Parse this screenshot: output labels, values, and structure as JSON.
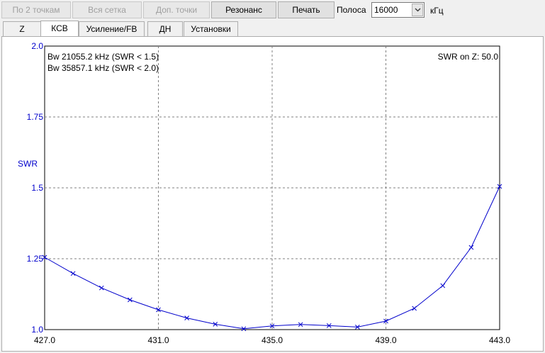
{
  "toolbar": {
    "buttons": [
      {
        "label": "По 2 точкам",
        "enabled": false
      },
      {
        "label": "Вся сетка",
        "enabled": false
      },
      {
        "label": "Доп. точки",
        "enabled": false
      },
      {
        "label": "Резонанс",
        "enabled": true
      },
      {
        "label": "Печать",
        "enabled": true
      }
    ],
    "band_label": "Полоса",
    "band_value": "16000",
    "band_unit": "кГц"
  },
  "tabs": [
    {
      "label": "Z",
      "active": false
    },
    {
      "label": "КСВ",
      "active": true
    },
    {
      "label": "Усиление/FB",
      "active": false
    },
    {
      "label": "ДН",
      "active": false
    },
    {
      "label": "Установки",
      "active": false
    }
  ],
  "colors": {
    "accent": "#0000cc",
    "grid": "#808080"
  },
  "chart_data": {
    "type": "line",
    "ylabel": "SWR",
    "xlim": [
      427.0,
      443.0
    ],
    "ylim": [
      1.0,
      2.0
    ],
    "x_ticks": [
      "427.0",
      "431.0",
      "435.0",
      "439.0",
      "443.0"
    ],
    "y_ticks": [
      "2.0",
      "1.75",
      "1.5",
      "1.25",
      "1.0"
    ],
    "grid": true,
    "annotations": {
      "bw1": "Bw 21055.2 kHz (SWR < 1.5)",
      "bw2": "Bw 35857.1 kHz (SWR < 2.0)",
      "swr_on_z": "SWR on Z: 50.0"
    },
    "series": [
      {
        "x": [
          427.0,
          428.0,
          429.0,
          430.0,
          431.0,
          432.0,
          433.0,
          434.0,
          435.0,
          436.0,
          437.0,
          438.0,
          439.0,
          440.0,
          441.0,
          442.0,
          443.0
        ],
        "y": [
          1.255,
          1.198,
          1.147,
          1.105,
          1.07,
          1.041,
          1.019,
          1.003,
          1.013,
          1.018,
          1.014,
          1.009,
          1.03,
          1.075,
          1.155,
          1.29,
          1.505
        ]
      }
    ]
  }
}
